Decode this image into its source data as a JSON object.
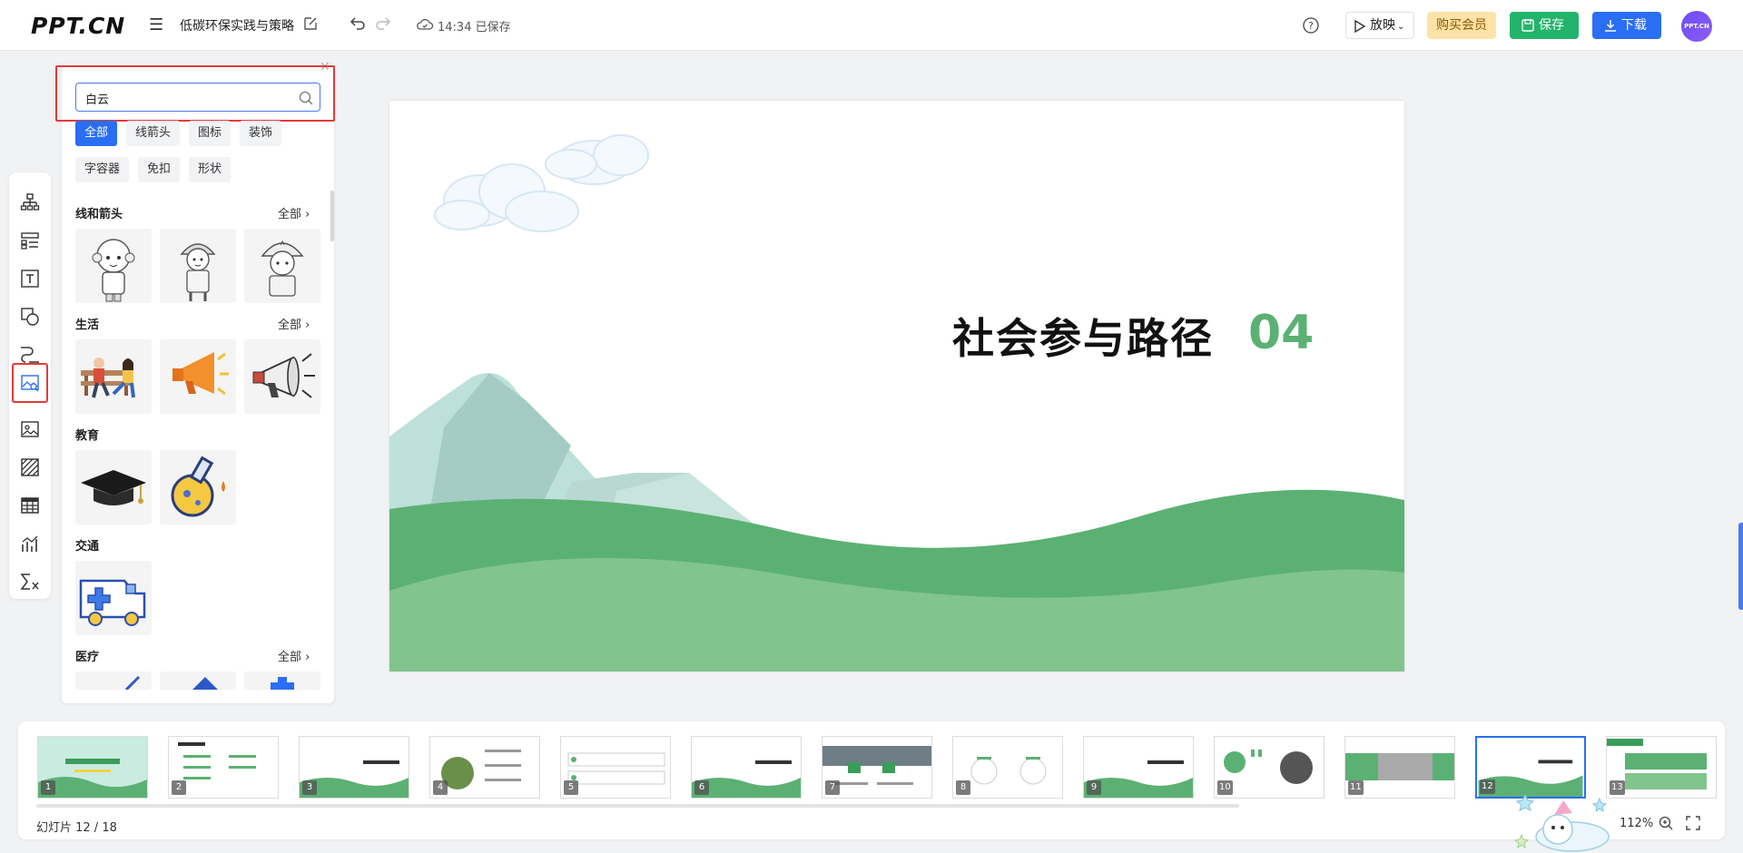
{
  "app": {
    "logo": "PPT.CN",
    "doc_title": "低碳环保实践与策略",
    "save_status": "14:34 已保存"
  },
  "toolbar": {
    "play_label": "放映",
    "vip_label": "购买会员",
    "save_label": "保存",
    "download_label": "下载",
    "avatar_label": "PPT.CN"
  },
  "side_tools": [
    {
      "name": "org-chart-icon"
    },
    {
      "name": "layout-list-icon"
    },
    {
      "name": "text-box-icon"
    },
    {
      "name": "shapes-icon"
    },
    {
      "name": "line-curve-icon"
    },
    {
      "name": "illustration-search-icon",
      "active": true
    },
    {
      "name": "image-icon"
    },
    {
      "name": "texture-icon"
    },
    {
      "name": "table-icon"
    },
    {
      "name": "chart-icon"
    },
    {
      "name": "formula-icon"
    }
  ],
  "panel": {
    "search_value": "白云",
    "filters": [
      {
        "label": "全部",
        "active": true
      },
      {
        "label": "线箭头"
      },
      {
        "label": "图标"
      },
      {
        "label": "装饰"
      },
      {
        "label": "字容器"
      },
      {
        "label": "免扣"
      },
      {
        "label": "形状"
      }
    ],
    "sections": [
      {
        "title": "线和箭头",
        "more": "全部"
      },
      {
        "title": "生活",
        "more": "全部"
      },
      {
        "title": "教育",
        "more": ""
      },
      {
        "title": "交通",
        "more": ""
      },
      {
        "title": "医疗",
        "more": "全部"
      }
    ]
  },
  "slide": {
    "title": "社会参与路径",
    "number": "04",
    "colors": {
      "accent": "#5bb173",
      "hill_dark": "#5bb173",
      "hill_light": "#82c48d",
      "mountain": "#a9d6cf"
    }
  },
  "filmstrip": {
    "slides": [
      "1",
      "2",
      "3",
      "4",
      "5",
      "6",
      "7",
      "8",
      "9",
      "10",
      "11",
      "12",
      "13"
    ],
    "active_index": 11,
    "counter": "幻灯片 12 / 18",
    "zoom": "112%"
  }
}
